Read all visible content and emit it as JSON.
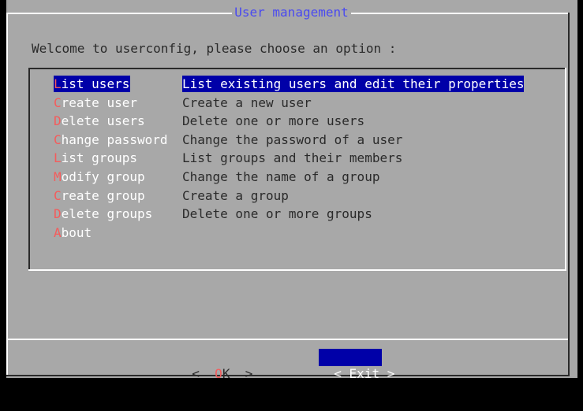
{
  "dialog": {
    "title": "User management",
    "prompt": "Welcome to userconfig, please choose an option :"
  },
  "menu": {
    "items": [
      {
        "hot": "L",
        "rest": "ist users",
        "desc": "List existing users and edit their properties",
        "selected": true
      },
      {
        "hot": "C",
        "rest": "reate user",
        "desc": "Create a new user",
        "selected": false
      },
      {
        "hot": "D",
        "rest": "elete users",
        "desc": "Delete one or more users",
        "selected": false
      },
      {
        "hot": "C",
        "rest": "hange password",
        "desc": "Change the password of a user",
        "selected": false
      },
      {
        "hot": "L",
        "rest": "ist groups",
        "desc": "List groups and their members",
        "selected": false
      },
      {
        "hot": "M",
        "rest": "odify group",
        "desc": "Change the name of a group",
        "selected": false
      },
      {
        "hot": "C",
        "rest": "reate group",
        "desc": "Create a group",
        "selected": false
      },
      {
        "hot": "D",
        "rest": "elete groups",
        "desc": "Delete one or more groups",
        "selected": false
      },
      {
        "hot": "A",
        "rest": "bout",
        "desc": "",
        "selected": false
      }
    ]
  },
  "buttons": {
    "ok": {
      "open": "<",
      "hot": "O",
      "rest": "K",
      "close": ">"
    },
    "exit": {
      "open": "<",
      "label": "Exit",
      "close": ">"
    }
  },
  "colors": {
    "dialog_bg": "#a8a8a8",
    "selection_bg": "#0000a8",
    "hotkey": "#f55b5b",
    "title": "#4a4af0",
    "screen_bg": "#000000"
  }
}
